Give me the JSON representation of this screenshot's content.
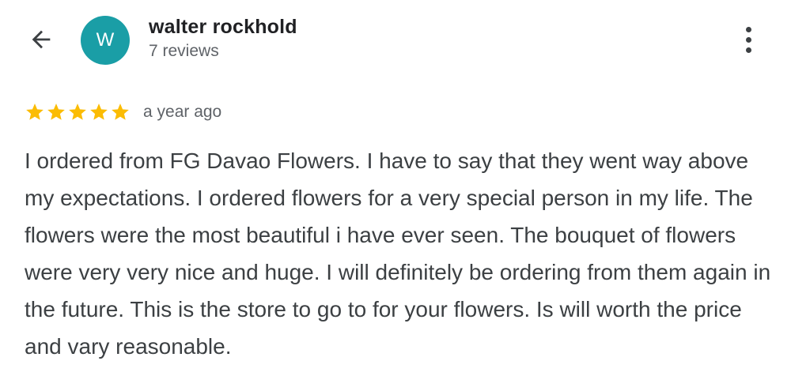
{
  "reviewer": {
    "avatar_letter": "W",
    "avatar_color": "#1a9ea6",
    "name": "walter rockhold",
    "review_count": "7 reviews"
  },
  "review": {
    "rating": 5,
    "rating_max": 5,
    "star_color": "#fbbc04",
    "time_ago": "a year ago",
    "text": "I ordered from FG Davao Flowers. I have to say that they went way above my expectations. I ordered flowers for a very special person in my life. The flowers were the most beautiful i have ever seen. The bouquet of flowers were very very nice and huge. I will definitely be ordering from them again in the future. This is the store to go to for your flowers. Is will worth the price and vary reasonable."
  },
  "icons": {
    "back": "arrow-back-icon",
    "more": "more-vert-icon",
    "star": "star-icon"
  }
}
